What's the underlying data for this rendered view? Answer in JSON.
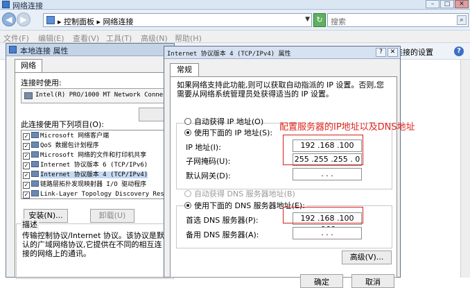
{
  "explorer": {
    "title": "网络连接",
    "breadcrumb": "▸ 控制面板 ▸ 网络连接",
    "search_placeholder": "搜索",
    "menu": [
      "文件(F)",
      "编辑(E)",
      "查看(V)",
      "工具(T)",
      "高级(N)",
      "帮助(H)"
    ],
    "toolbar_text": "连接的设置"
  },
  "props": {
    "title": "本地连接 属性",
    "tab": "网络",
    "connect_using_label": "连接时使用:",
    "adapter": "Intel(R) PRO/1000 MT Network Connec",
    "items_label": "此连接使用下列项目(O):",
    "items": [
      {
        "label": "Microsoft 网络客户端",
        "checked": true,
        "selected": false
      },
      {
        "label": "QoS 数据包计划程序",
        "checked": true,
        "selected": false
      },
      {
        "label": "Microsoft 网络的文件和打印机共享",
        "checked": true,
        "selected": false
      },
      {
        "label": "Internet 协议版本 6 (TCP/IPv6)",
        "checked": true,
        "selected": false
      },
      {
        "label": "Internet 协议版本 4 (TCP/IPv4)",
        "checked": true,
        "selected": true
      },
      {
        "label": "链路层拓扑发现映射器 I/O 驱动程序",
        "checked": true,
        "selected": false
      },
      {
        "label": "Link-Layer Topology Discovery Res",
        "checked": true,
        "selected": false
      }
    ],
    "install_button": "安装(N)...",
    "uninstall_button": "卸载(U)",
    "description_title": "描述",
    "description_text": "传输控制协议/Internet 协议。该协议是默认的广域网络协议,它提供在不同的相互连接的网络上的通讯。"
  },
  "ipv4": {
    "title": "Internet 协议版本 4 (TCP/IPv4) 属性",
    "help_label": "?",
    "close_label": "✕",
    "tab": "常规",
    "intro": "如果网络支持此功能,则可以获取自动指派的 IP 设置。否则,您需要从网络系统管理员处获得适当的 IP 设置。",
    "auto_ip_label": "自动获得 IP 地址(O)",
    "manual_ip_label": "使用下面的 IP 地址(S):",
    "ip_label": "IP 地址(I):",
    "ip_value": "192 .168 .100 .100",
    "mask_label": "子网掩码(U):",
    "mask_value": "255 .255 .255 . 0",
    "gateway_label": "默认网关(D):",
    "gateway_value": ". . .",
    "auto_dns_label": "自动获得 DNS 服务器地址(B)",
    "manual_dns_label": "使用下面的 DNS 服务器地址(E):",
    "pref_dns_label": "首选 DNS 服务器(P):",
    "pref_dns_value": "192 .168 .100 .100",
    "alt_dns_label": "备用 DNS 服务器(A):",
    "alt_dns_value": ". . .",
    "advanced_button": "高级(V)...",
    "ok_button": "确定",
    "cancel_button": "取消"
  },
  "annotation": "配置服务器的IP地址以及DNS地址",
  "colors": {
    "annotation": "#e0241c",
    "selected_row": "#c6d9f3",
    "title_bg": "#d6e2f1"
  }
}
